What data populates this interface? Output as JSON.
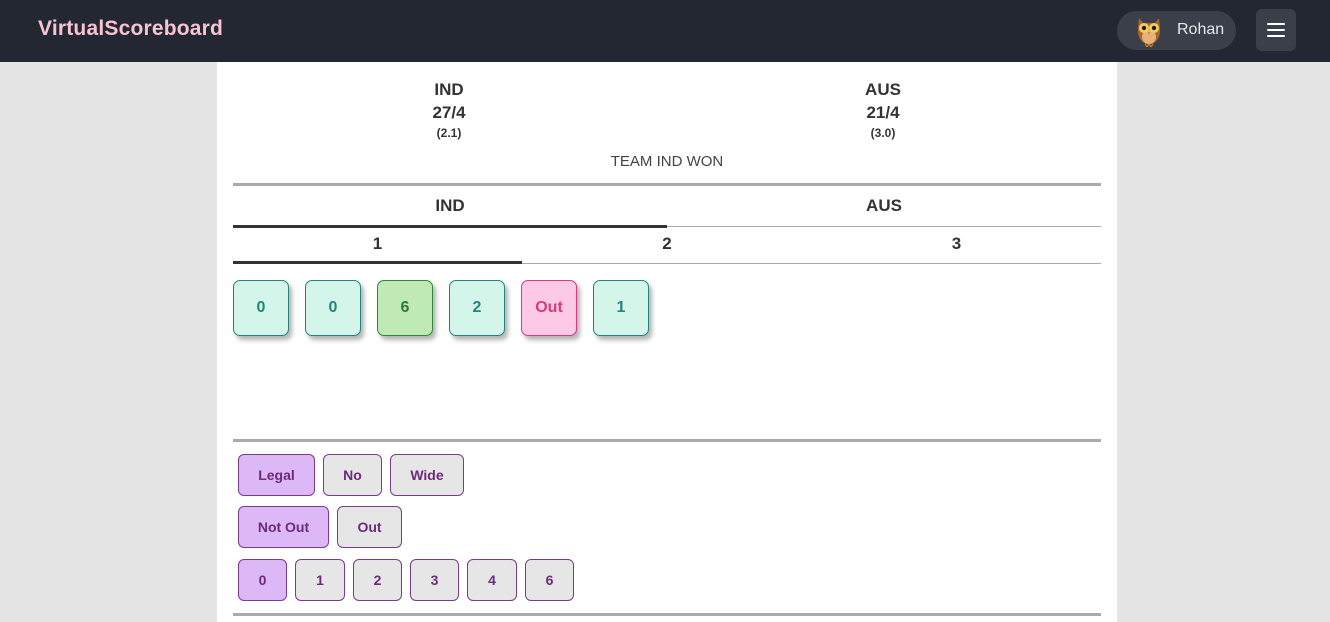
{
  "navbar": {
    "brand": "VirtualScoreboard",
    "user": {
      "name": "Rohan",
      "avatar_icon": "owl-avatar"
    },
    "menu_icon": "hamburger-icon"
  },
  "summary": {
    "teams": [
      {
        "name": "IND",
        "score": "27/4",
        "overs": "(2.1)"
      },
      {
        "name": "AUS",
        "score": "21/4",
        "overs": "(3.0)"
      }
    ],
    "result": "TEAM IND WON"
  },
  "team_tabs": [
    {
      "label": "IND",
      "active": true
    },
    {
      "label": "AUS",
      "active": false
    }
  ],
  "over_tabs": [
    {
      "label": "1",
      "active": true
    },
    {
      "label": "2",
      "active": false
    },
    {
      "label": "3",
      "active": false
    }
  ],
  "balls": [
    {
      "label": "0",
      "kind": "run"
    },
    {
      "label": "0",
      "kind": "run"
    },
    {
      "label": "6",
      "kind": "six"
    },
    {
      "label": "2",
      "kind": "run"
    },
    {
      "label": "Out",
      "kind": "out"
    },
    {
      "label": "1",
      "kind": "run"
    }
  ],
  "controls": {
    "delivery": [
      {
        "label": "Legal",
        "selected": true
      },
      {
        "label": "No",
        "selected": false
      },
      {
        "label": "Wide",
        "selected": false
      }
    ],
    "dismissal": [
      {
        "label": "Not Out",
        "selected": true
      },
      {
        "label": "Out",
        "selected": false
      }
    ],
    "runs": [
      {
        "label": "0",
        "selected": true
      },
      {
        "label": "1",
        "selected": false
      },
      {
        "label": "2",
        "selected": false
      },
      {
        "label": "3",
        "selected": false
      },
      {
        "label": "4",
        "selected": false
      },
      {
        "label": "6",
        "selected": false
      }
    ]
  },
  "colors": {
    "navbar": "#222732",
    "brand": "#f9c4d2",
    "run_ball": "#d3f5ea",
    "six_ball": "#bfeab6",
    "out_ball": "#fec9e5",
    "selected_option": "#dcb8f7",
    "option_border": "#7a3b8c"
  }
}
